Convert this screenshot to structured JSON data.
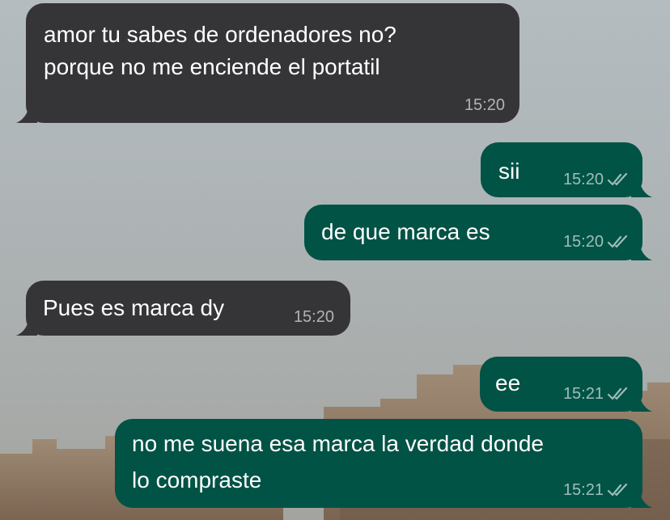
{
  "messages": [
    {
      "direction": "incoming",
      "lines": [
        "amor tu sabes de ordenadores no?",
        "porque no me enciende el portatil"
      ],
      "time": "15:20"
    },
    {
      "direction": "outgoing",
      "lines": [
        "sii"
      ],
      "time": "15:20",
      "read": true
    },
    {
      "direction": "outgoing",
      "lines": [
        "de que marca es"
      ],
      "time": "15:20",
      "read": true
    },
    {
      "direction": "incoming",
      "lines": [
        "Pues es marca dy"
      ],
      "time": "15:20"
    },
    {
      "direction": "outgoing",
      "lines": [
        "ee"
      ],
      "time": "15:21",
      "read": true
    },
    {
      "direction": "outgoing",
      "lines": [
        "no me suena esa marca la verdad donde",
        "lo compraste"
      ],
      "time": "15:21",
      "read": true
    }
  ],
  "colors": {
    "incoming_bubble": "#353538",
    "outgoing_bubble": "#005345",
    "text": "#ffffff",
    "meta": "#b8c2c0",
    "wallpaper": "#aeb4b6"
  },
  "icons": {
    "read_receipt": "double-check-icon"
  }
}
